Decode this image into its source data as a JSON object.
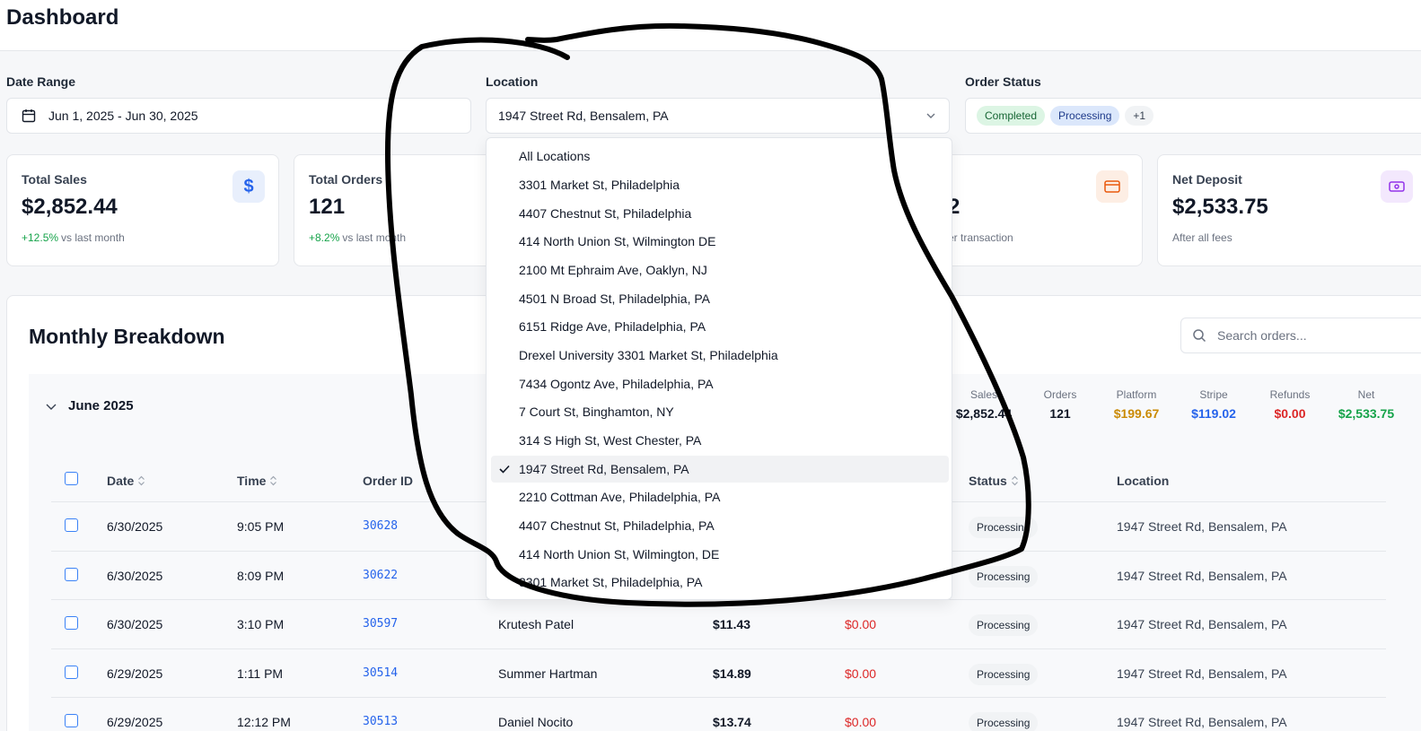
{
  "header": {
    "title": "Dashboard"
  },
  "filters": {
    "date_label": "Date Range",
    "date_value": "Jun 1, 2025 - Jun 30, 2025",
    "location_label": "Location",
    "location_value": "1947 Street Rd, Bensalem, PA",
    "status_label": "Order Status",
    "status_pills": [
      "Completed",
      "Processing",
      "+1"
    ]
  },
  "cards": [
    {
      "label": "Total Sales",
      "value": "$2,852.44",
      "delta": "+12.5%",
      "sub": "vs last month",
      "icon": "dollar-icon"
    },
    {
      "label": "Total Orders",
      "value": "121",
      "delta": "+8.2%",
      "sub": "vs last month"
    },
    {
      "value": "2",
      "sub": "er transaction",
      "icon": "credit-card-icon"
    },
    {
      "label": "Net Deposit",
      "value": "$2,533.75",
      "sub": "After all fees",
      "icon": "wallet-icon"
    }
  ],
  "breakdown": {
    "title": "Monthly Breakdown",
    "search_placeholder": "Search orders...",
    "month": "June 2025",
    "stats": [
      {
        "label": "Sales",
        "value": "$2,852.44"
      },
      {
        "label": "Orders",
        "value": "121"
      },
      {
        "label": "Platform",
        "value": "$199.67"
      },
      {
        "label": "Stripe",
        "value": "$119.02"
      },
      {
        "label": "Refunds",
        "value": "$0.00"
      },
      {
        "label": "Net",
        "value": "$2,533.75"
      }
    ],
    "columns": [
      "Date",
      "Time",
      "Order ID",
      "Status",
      "Location"
    ],
    "rows": [
      {
        "date": "6/30/2025",
        "time": "9:05 PM",
        "order_id": "30628",
        "customer": "",
        "amount": "",
        "refund": "",
        "status": "Processing",
        "location": "1947 Street Rd, Bensalem, PA"
      },
      {
        "date": "6/30/2025",
        "time": "8:09 PM",
        "order_id": "30622",
        "customer": "",
        "amount": "",
        "refund": "",
        "status": "Processing",
        "location": "1947 Street Rd, Bensalem, PA"
      },
      {
        "date": "6/30/2025",
        "time": "3:10 PM",
        "order_id": "30597",
        "customer": "Krutesh Patel",
        "amount": "$11.43",
        "refund": "$0.00",
        "status": "Processing",
        "location": "1947 Street Rd, Bensalem, PA"
      },
      {
        "date": "6/29/2025",
        "time": "1:11 PM",
        "order_id": "30514",
        "customer": "Summer Hartman",
        "amount": "$14.89",
        "refund": "$0.00",
        "status": "Processing",
        "location": "1947 Street Rd, Bensalem, PA"
      },
      {
        "date": "6/29/2025",
        "time": "12:12 PM",
        "order_id": "30513",
        "customer": "Daniel Nocito",
        "amount": "$13.74",
        "refund": "$0.00",
        "status": "Processing",
        "location": "1947 Street Rd, Bensalem, PA"
      }
    ]
  },
  "location_dropdown": {
    "selected": "1947 Street Rd, Bensalem, PA",
    "options": [
      "All Locations",
      "3301 Market St, Philadelphia",
      "4407 Chestnut St, Philadelphia",
      "414 North Union St, Wilmington DE",
      "2100 Mt Ephraim Ave, Oaklyn, NJ",
      "4501 N Broad St, Philadelphia, PA",
      "6151 Ridge Ave, Philadelphia, PA",
      "Drexel University 3301 Market St, Philadelphia",
      "7434 Ogontz Ave, Philadelphia, PA",
      "7 Court St, Binghamton, NY",
      "314 S High St, West Chester, PA",
      "1947 Street Rd, Bensalem, PA",
      "2210 Cottman Ave, Philadelphia, PA",
      "4407 Chestnut St, Philadelphia, PA",
      "414 North Union St, Wilmington, DE",
      "3301 Market St, Philadelphia, PA"
    ]
  },
  "colors": {
    "accent": "#2563eb",
    "positive": "#16a34a",
    "platform": "#ca8a04",
    "stripe": "#2563eb",
    "refund": "#dc2626",
    "net": "#16a34a",
    "annotation_ink": "#000000"
  }
}
